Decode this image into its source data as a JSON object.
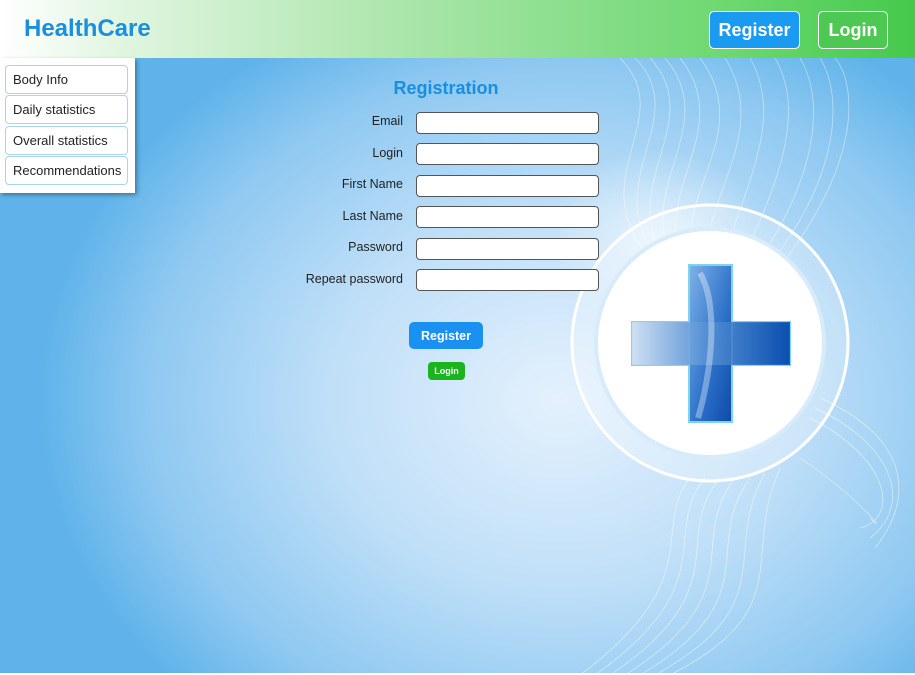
{
  "header": {
    "brand": "HealthCare",
    "register_label": "Register",
    "login_label": "Login"
  },
  "sidebar": {
    "items": [
      {
        "label": "Body Info"
      },
      {
        "label": "Daily statistics"
      },
      {
        "label": "Overall statistics"
      },
      {
        "label": "Recommendations"
      }
    ]
  },
  "form": {
    "title": "Registration",
    "fields": [
      {
        "label": "Email",
        "value": ""
      },
      {
        "label": "Login",
        "value": ""
      },
      {
        "label": "First Name",
        "value": ""
      },
      {
        "label": "Last Name",
        "value": ""
      },
      {
        "label": "Password",
        "value": ""
      },
      {
        "label": "Repeat password",
        "value": ""
      }
    ],
    "register_label": "Register",
    "login_label": "Login"
  },
  "decoration": {
    "icon": "medical-cross-icon",
    "colors": {
      "brand_blue": "#1a8fe0",
      "header_green": "#45c94b",
      "cross_blue": "#1565c0"
    }
  }
}
